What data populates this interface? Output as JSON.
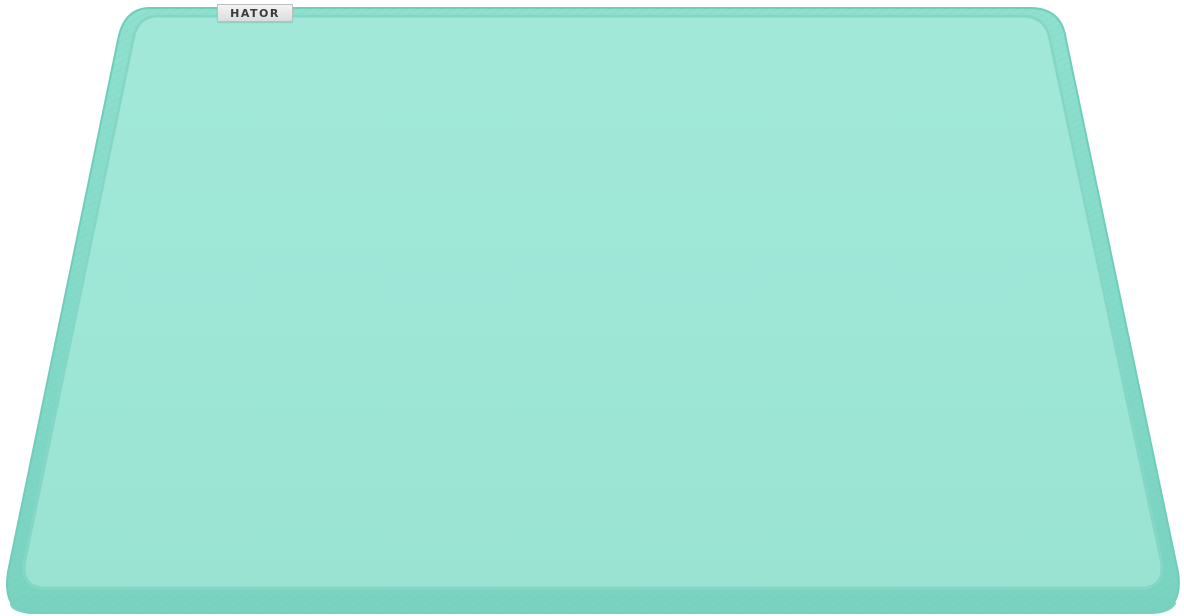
{
  "product": {
    "brand_label": "HATOR"
  },
  "colors": {
    "surface": "#9de6d6",
    "stitched_edge": "#7fd8c6",
    "edge_shadow": "#63c4b0",
    "tag_background": "#e6e6e6",
    "tag_text": "#3a3a3a"
  },
  "icons": {
    "pad": "mousepad-illustration"
  }
}
